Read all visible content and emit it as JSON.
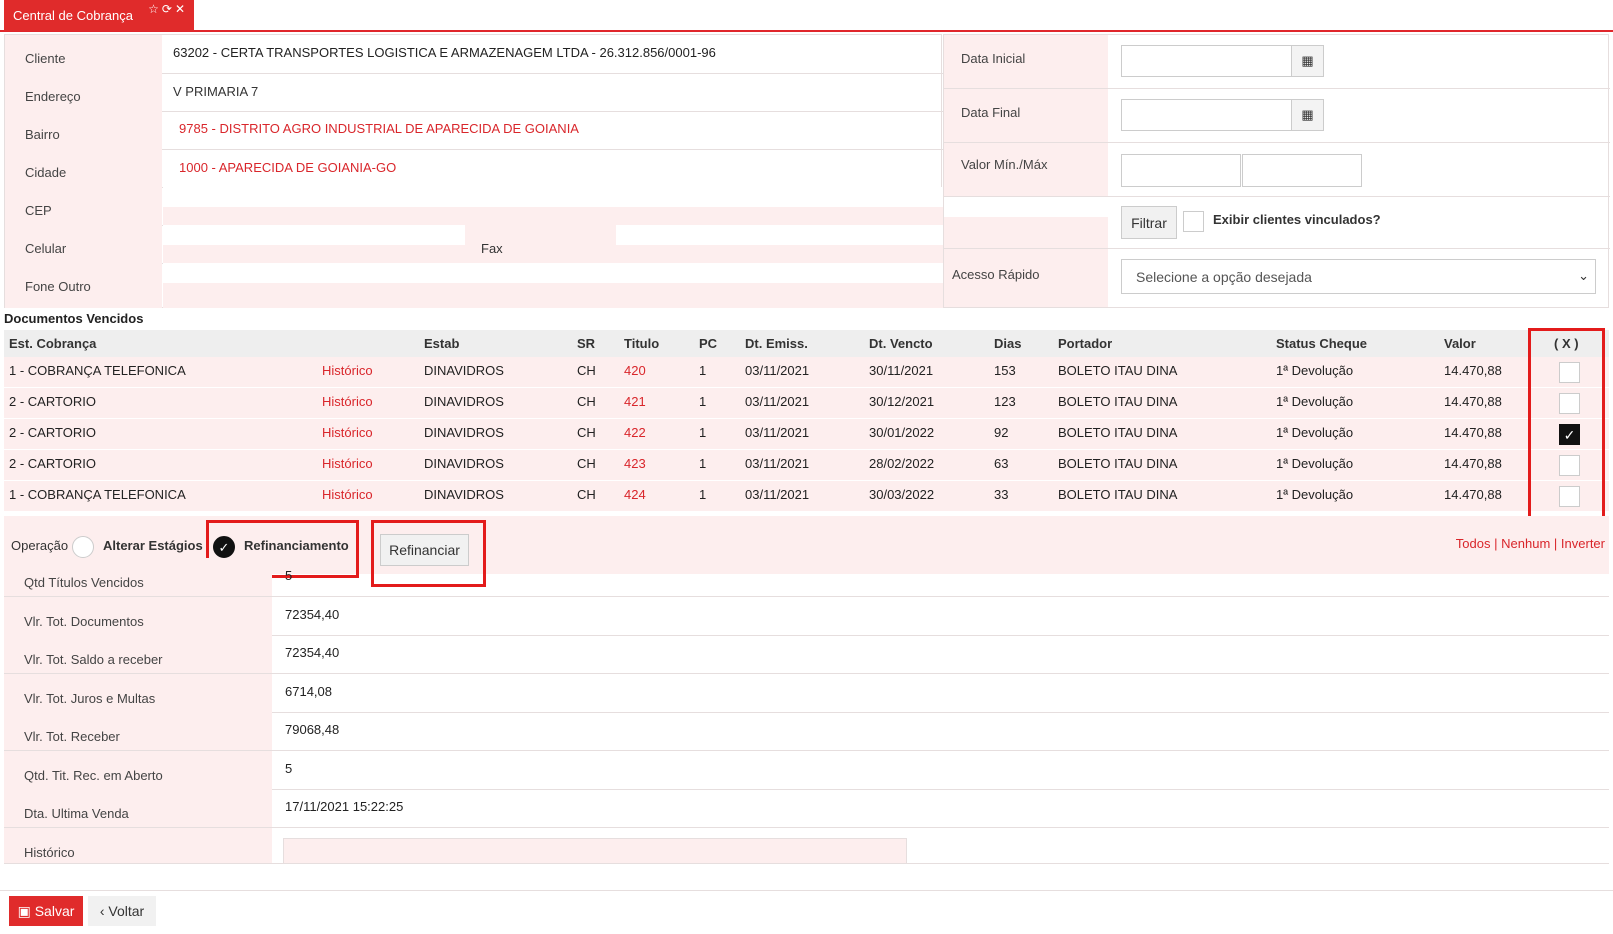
{
  "tab": {
    "title": "Central de Cobrança",
    "icons": [
      "star-icon",
      "refresh-icon",
      "close-icon"
    ]
  },
  "client_info": [
    {
      "label": "Cliente",
      "value": "63202 - CERTA TRANSPORTES LOGISTICA E ARMAZENAGEM LTDA - 26.312.856/0001-96"
    },
    {
      "label": "Endereço",
      "value": "V PRIMARIA 7"
    },
    {
      "label": "Bairro",
      "value": "9785 - DISTRITO AGRO INDUSTRIAL DE APARECIDA DE GOIANIA"
    },
    {
      "label": "Cidade",
      "value": "1000 - APARECIDA DE GOIANIA-GO"
    },
    {
      "label": "CEP",
      "value": ""
    },
    {
      "label": "Celular",
      "value": "",
      "fax_label": "Fax",
      "fax_value": ""
    },
    {
      "label": "Fone Outro",
      "value": ""
    }
  ],
  "filters": {
    "data_inicial": {
      "label": "Data Inicial",
      "value": ""
    },
    "data_final": {
      "label": "Data Final",
      "value": ""
    },
    "valor": {
      "label": "Valor Mín./Máx",
      "min": "",
      "max": ""
    },
    "filter_button": "Filtrar",
    "linked_clients_label": "Exibir clientes vinculados?",
    "acesso_rapido": {
      "label": "Acesso Rápido",
      "placeholder": "Selecione a opção desejada"
    }
  },
  "documents": {
    "title": "Documentos Vencidos",
    "columns": [
      "Est. Cobrança",
      "Estab",
      "SR",
      "Titulo",
      "PC",
      "Dt. Emiss.",
      "Dt. Vencto",
      "Dias",
      "Portador",
      "Status Cheque",
      "Valor",
      "( X )"
    ],
    "rows": [
      {
        "est": "1 - COBRANÇA TELEFONICA",
        "hist": "Histórico",
        "estab": "DINAVIDROS",
        "sr": "CH",
        "titulo": "420",
        "pc": "1",
        "emiss": "03/11/2021",
        "vencto": "30/11/2021",
        "dias": "153",
        "portador": "BOLETO ITAU DINA",
        "status": "1ª Devolução",
        "valor": "14.470,88",
        "checked": false
      },
      {
        "est": "2 - CARTORIO",
        "hist": "Histórico",
        "estab": "DINAVIDROS",
        "sr": "CH",
        "titulo": "421",
        "pc": "1",
        "emiss": "03/11/2021",
        "vencto": "30/12/2021",
        "dias": "123",
        "portador": "BOLETO ITAU DINA",
        "status": "1ª Devolução",
        "valor": "14.470,88",
        "checked": false
      },
      {
        "est": "2 - CARTORIO",
        "hist": "Histórico",
        "estab": "DINAVIDROS",
        "sr": "CH",
        "titulo": "422",
        "pc": "1",
        "emiss": "03/11/2021",
        "vencto": "30/01/2022",
        "dias": "92",
        "portador": "BOLETO ITAU DINA",
        "status": "1ª Devolução",
        "valor": "14.470,88",
        "checked": true
      },
      {
        "est": "2 - CARTORIO",
        "hist": "Histórico",
        "estab": "DINAVIDROS",
        "sr": "CH",
        "titulo": "423",
        "pc": "1",
        "emiss": "03/11/2021",
        "vencto": "28/02/2022",
        "dias": "63",
        "portador": "BOLETO ITAU DINA",
        "status": "1ª Devolução",
        "valor": "14.470,88",
        "checked": false
      },
      {
        "est": "1 - COBRANÇA TELEFONICA",
        "hist": "Histórico",
        "estab": "DINAVIDROS",
        "sr": "CH",
        "titulo": "424",
        "pc": "1",
        "emiss": "03/11/2021",
        "vencto": "30/03/2022",
        "dias": "33",
        "portador": "BOLETO ITAU DINA",
        "status": "1ª Devolução",
        "valor": "14.470,88",
        "checked": false
      }
    ]
  },
  "operation": {
    "label": "Operação",
    "option1": "Alterar Estágios",
    "option2": "Refinanciamento",
    "selected": "Refinanciamento",
    "refinanciar_button": "Refinanciar",
    "select_all": "Todos",
    "select_none": "Nenhum",
    "invert": "Inverter",
    "sep": "|"
  },
  "totals": [
    {
      "label": "Qtd Títulos Vencidos",
      "value": "5"
    },
    {
      "label": "Vlr. Tot. Documentos",
      "value": "72354,40"
    },
    {
      "label": "Vlr. Tot. Saldo a receber",
      "value": "72354,40"
    },
    {
      "label": "Vlr. Tot. Juros e Multas",
      "value": "6714,08"
    },
    {
      "label": "Vlr. Tot. Receber",
      "value": "79068,48"
    },
    {
      "label": "Qtd. Tit. Rec. em Aberto",
      "value": "5"
    },
    {
      "label": "Dta. Ultima Venda",
      "value": "17/11/2021 15:22:25"
    },
    {
      "label": "Histórico",
      "value": ""
    }
  ],
  "footer": {
    "save": "Salvar",
    "back": "Voltar"
  },
  "colors": {
    "accent": "#e02b2b",
    "label_bg": "#fdeeee",
    "highlight": "#e31b1b"
  }
}
